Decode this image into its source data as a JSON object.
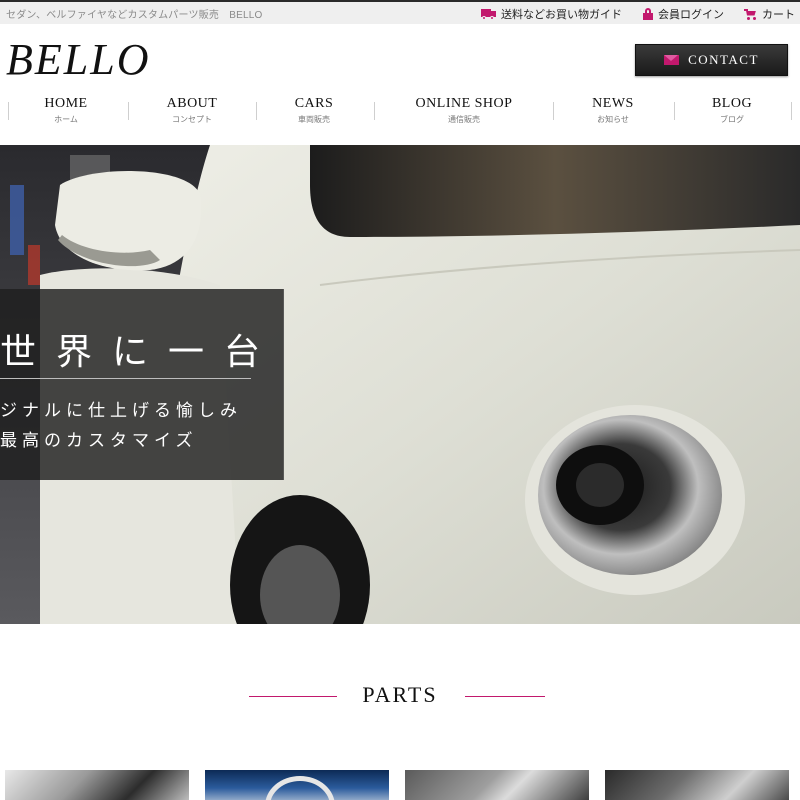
{
  "top_bar": {
    "tagline": "セダン、ベルファイヤなどカスタムパーツ販売　BELLO",
    "links": [
      {
        "label": "送料などお買い物ガイド",
        "icon": "truck-icon"
      },
      {
        "label": "会員ログイン",
        "icon": "lock-icon"
      },
      {
        "label": "カート",
        "icon": "cart-icon"
      }
    ]
  },
  "header": {
    "logo": "BELLO",
    "contact_label": "CONTACT"
  },
  "nav": [
    {
      "en": "HOME",
      "jp": "ホーム"
    },
    {
      "en": "ABOUT",
      "jp": "コンセプト"
    },
    {
      "en": "CARS",
      "jp": "車両販売"
    },
    {
      "en": "ONLINE SHOP",
      "jp": "通信販売"
    },
    {
      "en": "NEWS",
      "jp": "お知らせ"
    },
    {
      "en": "BLOG",
      "jp": "ブログ"
    }
  ],
  "hero": {
    "title": "世界に一台",
    "line1": "ジナルに仕上げる愉しみ",
    "line2": "最高のカスタマイズ"
  },
  "parts": {
    "heading": "PARTS"
  },
  "colors": {
    "accent": "#c2186d",
    "dark_button": "#2a2a2a",
    "top_bar_bg": "#efefef"
  }
}
